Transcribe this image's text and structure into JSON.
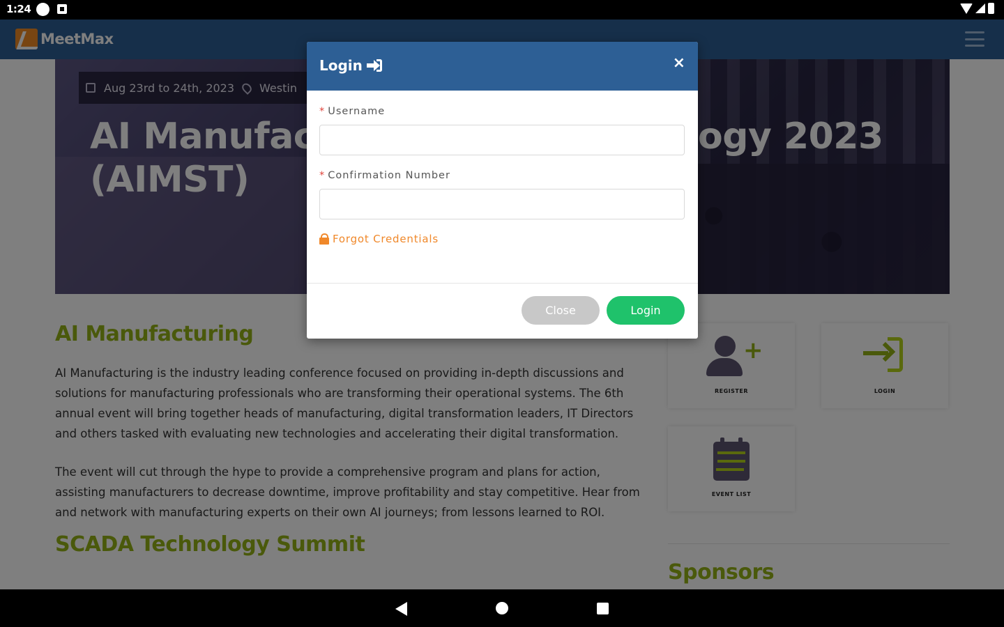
{
  "status_bar": {
    "time": "1:24"
  },
  "app": {
    "logo_text": "MeetMax",
    "hero": {
      "date": "Aug 23rd to 24th, 2023",
      "location": "Westin",
      "title_line1": "AI Manufactu",
      "title_year": "ogy 2023",
      "title_line2": "(AIMST)"
    },
    "section1": {
      "heading": "AI Manufacturing",
      "para1": "AI Manufacturing is the industry leading conference focused on providing in-depth discussions and solutions for manufacturing professionals who are transforming their operational systems. The 6th annual event will bring together heads of manufacturing, digital transformation leaders, IT Directors and others tasked with evaluating new technologies and accelerating their digital transformation.",
      "para2": "The event will cut through the hype to provide a comprehensive program and plans for action, assisting manufacturers to decrease downtime, improve profitability and stay competitive. Hear from and network with manufacturing experts on their own AI journeys; from lessons learned to ROI."
    },
    "section2": {
      "heading": "SCADA Technology Summit"
    },
    "tiles": {
      "register": "REGISTER",
      "login": "LOGIN",
      "event_list": "EVENT LIST"
    },
    "sponsors_heading": "Sponsors"
  },
  "modal": {
    "title": "Login",
    "close_x": "×",
    "username_label": "Username",
    "username_value": "",
    "confirmation_label": "Confirmation Number",
    "confirmation_value": "",
    "required_mark": "*",
    "forgot_link": "Forgot Credentials",
    "close_button": "Close",
    "login_button": "Login"
  },
  "colors": {
    "header_blue": "#2d5f95",
    "accent_green": "#94b316",
    "login_green": "#1fc26b",
    "forgot_orange": "#f0882a"
  },
  "icons": [
    "wifi-icon",
    "signal-icon",
    "battery-icon",
    "sign-in-icon",
    "lock-icon",
    "user-plus-icon",
    "login-icon",
    "calendar-icon",
    "map-pin-icon",
    "hamburger-icon"
  ]
}
